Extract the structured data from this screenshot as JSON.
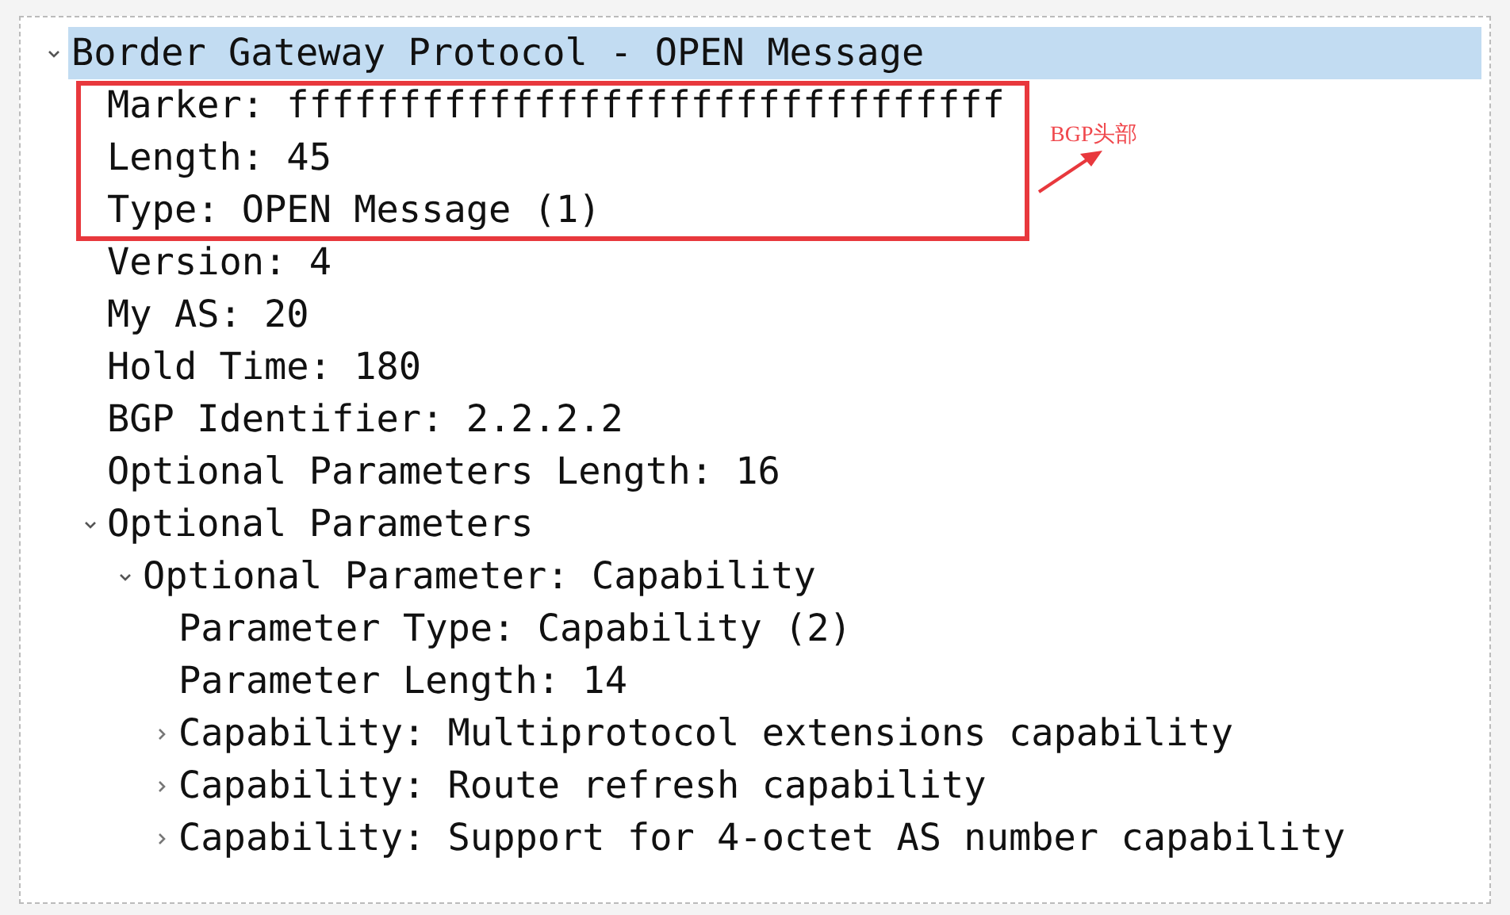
{
  "tree": [
    {
      "label": "Border Gateway Protocol - OPEN Message",
      "selected": true,
      "expanded": true,
      "children": [
        {
          "label": "Marker: ffffffffffffffffffffffffffffffff",
          "selected": false
        },
        {
          "label": "Length: 45",
          "selected": false
        },
        {
          "label": "Type: OPEN Message (1)",
          "selected": false
        },
        {
          "label": "Version: 4",
          "selected": false
        },
        {
          "label": "My AS: 20",
          "selected": false
        },
        {
          "label": "Hold Time: 180",
          "selected": false
        },
        {
          "label": "BGP Identifier: 2.2.2.2",
          "selected": false
        },
        {
          "label": "Optional Parameters Length: 16",
          "selected": false
        },
        {
          "label": "Optional Parameters",
          "selected": false,
          "expanded": true,
          "children": [
            {
              "label": "Optional Parameter: Capability",
              "selected": false,
              "expanded": true,
              "children": [
                {
                  "label": "Parameter Type: Capability (2)",
                  "selected": false
                },
                {
                  "label": "Parameter Length: 14",
                  "selected": false
                },
                {
                  "label": "Capability: Multiprotocol extensions capability",
                  "selected": false,
                  "expanded": false
                },
                {
                  "label": "Capability: Route refresh capability",
                  "selected": false,
                  "expanded": false
                },
                {
                  "label": "Capability: Support for 4-octet AS number capability",
                  "selected": false,
                  "expanded": false
                }
              ]
            }
          ]
        }
      ]
    }
  ],
  "annotation": {
    "label": "BGP头部"
  }
}
